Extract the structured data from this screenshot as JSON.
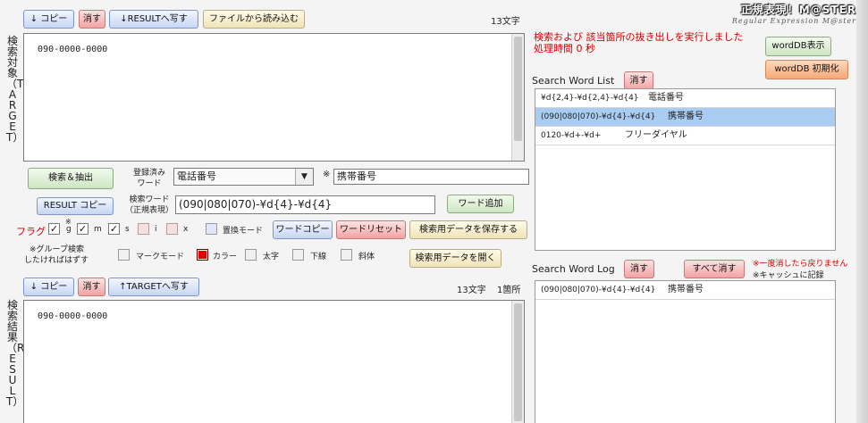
{
  "logo": {
    "title": "正規表現！M@STER",
    "subtitle": "Regular Expression M@ster"
  },
  "target": {
    "label": "検索対象（TARGET）",
    "copy_button": "↓ コピー",
    "clear_button": "消す",
    "to_result_button": "↓RESULTへ写す",
    "load_file_button": "ファイルから読み込む",
    "char_count": "13文字",
    "text": "090-0000-0000"
  },
  "controls": {
    "search_extract_button": "検索＆抽出",
    "result_copy_button": "RESULT コピー",
    "registered_word_label_1": "登録済み",
    "registered_word_label_2": "ワード",
    "registered_word_value": "電話番号",
    "note_mark": "※",
    "note_value": "携帯番号",
    "search_word_label_1": "検索ワード",
    "search_word_label_2": "（正規表現）",
    "search_word_value": "(090|080|070)-¥d{4}-¥d{4}",
    "add_word_button": "ワード追加",
    "flag_label": "フラグ",
    "flag_g": "g",
    "flag_g_note": "※",
    "flag_m": "m",
    "flag_s": "s",
    "flag_i": "i",
    "flag_x": "x",
    "replace_mode_label": "置換モード",
    "word_copy_button": "ワードコピー",
    "word_reset_button": "ワードリセット",
    "save_search_button": "検索用データを保存する",
    "open_search_button": "検索用データを開く",
    "group_note_1": "※グループ検索",
    "group_note_2": "したければはずす",
    "mark_mode_label": "マークモード",
    "color_label": "カラー",
    "bold_label": "太字",
    "underline_label": "下線",
    "italic_label": "斜体",
    "color_swatch": "#e00000"
  },
  "result": {
    "label": "検索結果（RESULT）",
    "copy_button": "↓ コピー",
    "clear_button": "消す",
    "to_target_button": "↑TARGETへ写す",
    "char_count": "13文字",
    "match_count": "1箇所",
    "text": "090-0000-0000"
  },
  "status": {
    "message": "検索および 該当箇所の抜き出しを実行しました",
    "time": "処理時間 0 秒"
  },
  "worddb": {
    "show_button": "wordDB表示",
    "init_button": "wordDB 初期化"
  },
  "word_list": {
    "title": "Search Word List",
    "clear_button": "消す",
    "rows": [
      {
        "pattern": "¥d{2,4}-¥d{2,4}-¥d{4}",
        "name": "電話番号"
      },
      {
        "pattern": "(090|080|070)-¥d{4}-¥d{4}",
        "name": "携帯番号"
      },
      {
        "pattern": "0120-¥d+-¥d+",
        "name": "フリーダイヤル"
      }
    ]
  },
  "word_log": {
    "title": "Search Word Log",
    "clear_button": "消す",
    "clear_all_button": "すべて消す",
    "warning_1": "※一度消したら戻りません",
    "warning_2": "※キャッシュに記録",
    "rows": [
      {
        "pattern": "(090|080|070)-¥d{4}-¥d{4}",
        "name": "携帯番号"
      }
    ]
  }
}
